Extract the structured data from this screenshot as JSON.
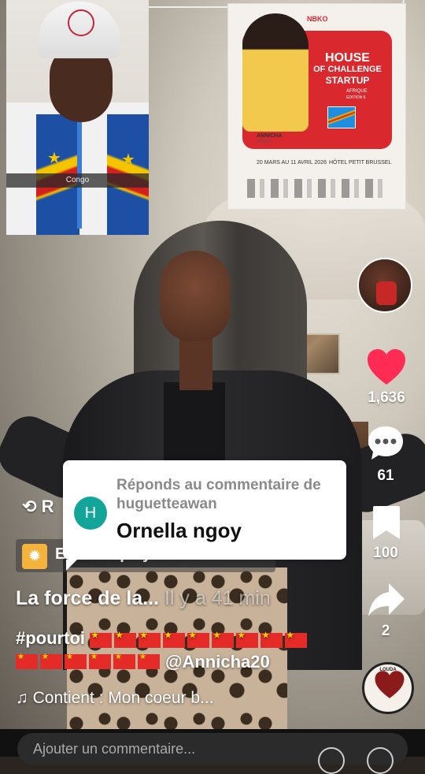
{
  "overlay_photo": {
    "caption": "Congo"
  },
  "poster": {
    "brand": "NBKO",
    "title_line1": "HOUSE",
    "title_line2": "OF CHALLENGE",
    "title_line3": "STARTUP",
    "subtitle": "AFRIQUE",
    "edition": "EDITION 6",
    "candidate_name": "ANNICHA",
    "candidate_country": "CONGO",
    "dates": "20 MARS AU 11 AVRIL 2026",
    "location": "HÔTEL PETIT BRUSSEL"
  },
  "rail": {
    "likes": "1,636",
    "comments": "61",
    "bookmarks": "100",
    "shares": "2",
    "disc_label": "LOUDA"
  },
  "reply": {
    "avatar_letter": "H",
    "label": "Réponds au commentaire de huguetteawan",
    "name": "Ornella ngoy"
  },
  "post": {
    "repost_label": "R",
    "effect_label": "E... les Spicy Glam 2",
    "title": "La force de la...",
    "time": "Il y a 41 min",
    "hashtag": "#pourtoi",
    "mention": "@Annicha20",
    "music": "Contient : Mon coeur b..."
  },
  "comment_bar": {
    "placeholder": "Ajouter un commentaire..."
  },
  "colors": {
    "accent_red": "#fe2c55",
    "reply_avatar": "#14a59a"
  }
}
